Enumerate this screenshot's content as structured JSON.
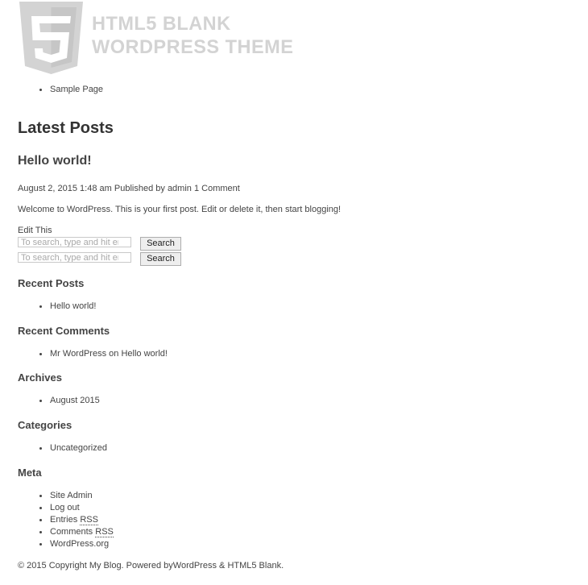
{
  "header": {
    "logo_line_1": "HTML5 BLANK",
    "logo_line_2": "WORDPRESS THEME",
    "logo_mark": "5"
  },
  "nav": {
    "items": [
      "Sample Page"
    ]
  },
  "main": {
    "section_heading": "Latest Posts",
    "post": {
      "title": "Hello world!",
      "date": "August 2, 2015 1:48 am",
      "published_by_prefix": "Published by",
      "author": "admin",
      "comments": "1 Comment",
      "excerpt": "Welcome to WordPress. This is your first post. Edit or delete it, then start blogging!",
      "edit_link": "Edit This"
    }
  },
  "search_forms": [
    {
      "placeholder": "To search, type and hit enter",
      "button": "Search"
    },
    {
      "placeholder": "To search, type and hit enter",
      "button": "Search"
    }
  ],
  "widgets": {
    "recent_posts": {
      "title": "Recent Posts",
      "items": [
        "Hello world!"
      ]
    },
    "recent_comments": {
      "title": "Recent Comments",
      "items": [
        {
          "author": "Mr WordPress",
          "on": "on",
          "post": "Hello world!"
        }
      ]
    },
    "archives": {
      "title": "Archives",
      "items": [
        "August 2015"
      ]
    },
    "categories": {
      "title": "Categories",
      "items": [
        "Uncategorized"
      ]
    },
    "meta": {
      "title": "Meta",
      "site_admin": "Site Admin",
      "log_out": "Log out",
      "entries_prefix": "Entries",
      "comments_prefix": "Comments",
      "rss": "RSS",
      "wordpress_org": "WordPress.org"
    }
  },
  "footer": {
    "copyright": "© 2015 Copyright My Blog. Powered by",
    "wordpress_link": "WordPress",
    "amp": "&",
    "theme_link": "HTML5 Blank",
    "period": "."
  },
  "colors": {
    "text": "#444444",
    "logo": "#d3d3d3",
    "background": "#ffffff"
  }
}
